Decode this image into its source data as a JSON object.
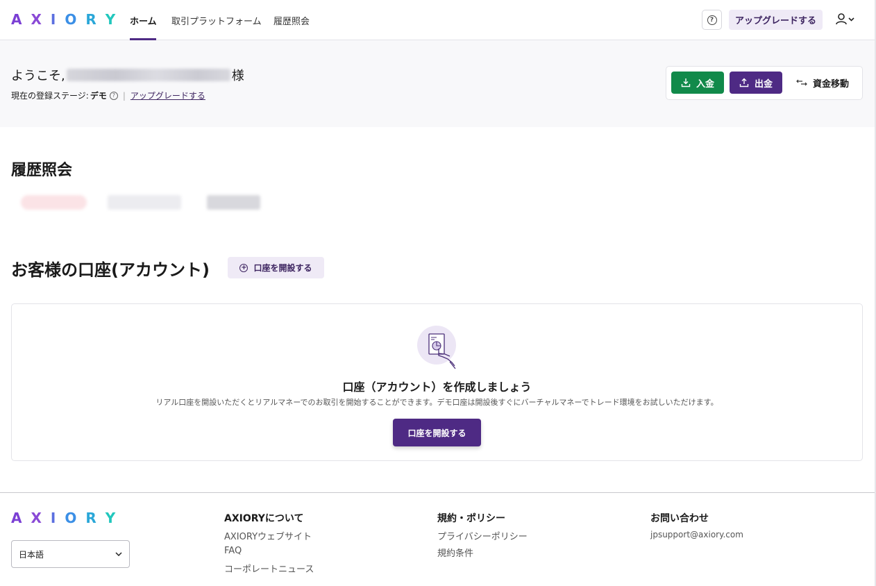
{
  "brand": {
    "logo_letters": [
      "A",
      "X",
      "I",
      "O",
      "R",
      "Y"
    ],
    "logo_colors": [
      "#7b3fd4",
      "#8a4ad6",
      "#5b6fe0",
      "#3b8fe6",
      "#2aa7d8",
      "#22c7bd"
    ]
  },
  "nav": {
    "items": [
      {
        "label": "ホーム",
        "active": true
      },
      {
        "label": "取引プラットフォーム",
        "active": false
      },
      {
        "label": "履歴照会",
        "active": false
      }
    ],
    "help_icon": "?",
    "upgrade_label": "アップグレードする",
    "user_icon": "user-icon"
  },
  "welcome": {
    "greeting_prefix": "ようこそ,",
    "greeting_suffix": "様",
    "stage_label": "現在の登録ステージ:",
    "stage_value": "デモ",
    "stage_help": "?",
    "separator": "|",
    "upgrade_link": "アップグレードする"
  },
  "actions": {
    "deposit_label": "入金",
    "withdraw_label": "出金",
    "transfer_label": "資金移動",
    "deposit_color": "#118a4a",
    "withdraw_color": "#4e2a84"
  },
  "history": {
    "title": "履歴照会"
  },
  "accounts": {
    "title": "お客様の口座(アカウント)",
    "open_small_label": "口座を開設する",
    "empty_title": "口座（アカウント）を作成しましょう",
    "empty_desc": "リアル口座を開設いただくとリアルマネーでのお取引を開始することができます。デモ口座は開設後すぐにバーチャルマネーでトレード環境をお試しいただけます。",
    "open_main_label": "口座を開設する"
  },
  "footer": {
    "language": "日本語",
    "columns": [
      {
        "heading": "AXIORYについて",
        "links": [
          "AXIORYウェブサイト",
          "FAQ",
          "コーポレートニュース"
        ]
      },
      {
        "heading": "規約・ポリシー",
        "links": [
          "プライバシーポリシー",
          "規約条件"
        ]
      },
      {
        "heading": "お問い合わせ",
        "links": [
          "jpsupport@axiory.com"
        ]
      }
    ]
  },
  "colors": {
    "accent": "#4e2a84",
    "accent_light": "#efeaf6",
    "success": "#118a4a"
  }
}
